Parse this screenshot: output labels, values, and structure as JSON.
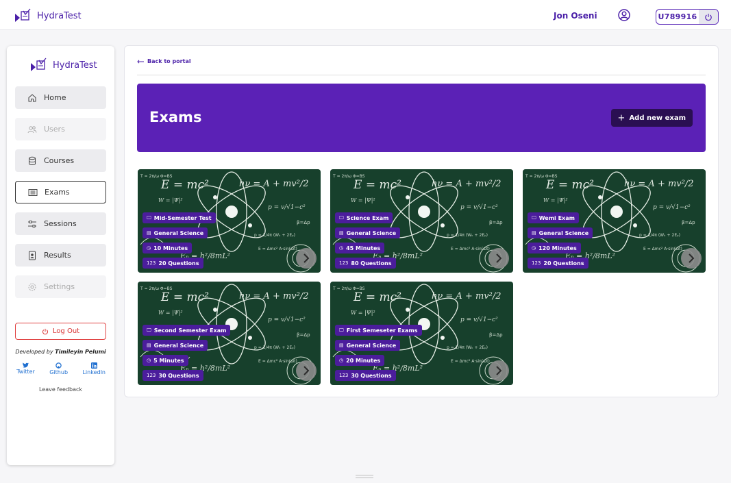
{
  "app": {
    "name": "HydraTest"
  },
  "header": {
    "user_name": "Jon Oseni",
    "user_id": "U789916"
  },
  "sidebar": {
    "brand": "HydraTest",
    "items": [
      {
        "label": "Home",
        "icon": "home-icon",
        "state": "normal"
      },
      {
        "label": "Users",
        "icon": "users-icon",
        "state": "disabled"
      },
      {
        "label": "Courses",
        "icon": "database-icon",
        "state": "normal"
      },
      {
        "label": "Exams",
        "icon": "list-icon",
        "state": "active"
      },
      {
        "label": "Sessions",
        "icon": "sliders-icon",
        "state": "normal"
      },
      {
        "label": "Results",
        "icon": "document-icon",
        "state": "normal"
      },
      {
        "label": "Settings",
        "icon": "gear-icon",
        "state": "disabled"
      }
    ],
    "logout_label": "Log Out",
    "developed_by_prefix": "Developed by",
    "developer": "Timileyin Pelumi",
    "socials": [
      {
        "label": "Twitter",
        "icon": "twitter-icon"
      },
      {
        "label": "Github",
        "icon": "github-icon"
      },
      {
        "label": "LinkedIn",
        "icon": "linkedin-icon"
      }
    ],
    "feedback_label": "Leave feedback"
  },
  "main": {
    "back_label": "Back to portal",
    "title": "Exams",
    "add_button_label": "Add new exam",
    "exams": [
      {
        "name": "Mid-Semester Test",
        "course": "General Science",
        "duration": "10 Minutes",
        "questions": "20 Questions"
      },
      {
        "name": "Science Exam",
        "course": "General Science",
        "duration": "45 Minutes",
        "questions": "80 Questions"
      },
      {
        "name": "Wemi Exam",
        "course": "General Science",
        "duration": "120 Minutes",
        "questions": "20 Questions"
      },
      {
        "name": "Second Semester Exam",
        "course": "General Science",
        "duration": "5 Minutes",
        "questions": "30 Questions"
      },
      {
        "name": "First Semeseter Exams",
        "course": "General Science",
        "duration": "20 Minutes",
        "questions": "30 Questions"
      }
    ]
  },
  "theme": {
    "primary": "#5b21b6",
    "dark": "#2a0f52",
    "danger": "#d83030",
    "card_bg": "#1d4a33"
  }
}
